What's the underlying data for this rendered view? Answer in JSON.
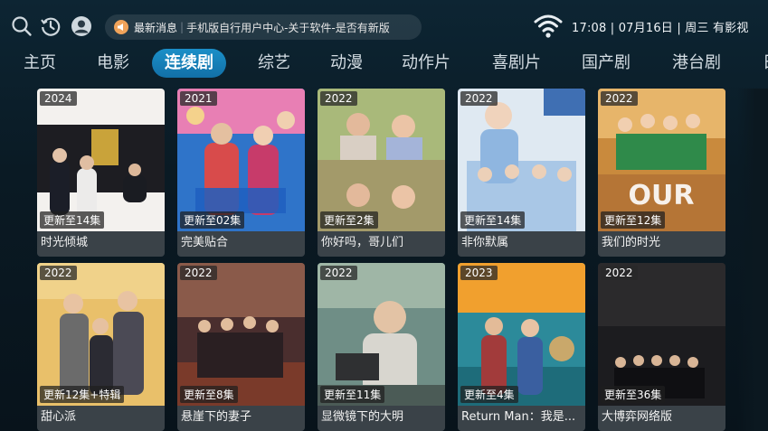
{
  "header": {
    "icons": [
      "search-icon",
      "history-icon",
      "user-icon"
    ],
    "news_label": "最新消息",
    "news_text": "手机版自行用户中心-关于软件-是否有新版",
    "status_text": "17:08 | 07月16日 | 周三  有影视"
  },
  "nav": {
    "tabs": [
      "主页",
      "电影",
      "连续剧",
      "综艺",
      "动漫",
      "动作片",
      "喜剧片",
      "国产剧",
      "港台剧",
      "日"
    ],
    "active": "连续剧"
  },
  "colors": {
    "accent": "#1a86c0",
    "title_bar": "#3a4248"
  },
  "cards": [
    {
      "year": "2024",
      "episodes": "更新至14集",
      "title": "时光倾城"
    },
    {
      "year": "2021",
      "episodes": "更新至02集",
      "title": "完美贴合"
    },
    {
      "year": "2022",
      "episodes": "更新至2集",
      "title": "你好吗，哥儿们"
    },
    {
      "year": "2022",
      "episodes": "更新至14集",
      "title": "非你默属"
    },
    {
      "year": "2022",
      "episodes": "更新至12集",
      "title": "我们的时光"
    },
    {
      "year": "2022",
      "episodes": "更新12集+特辑",
      "title": "甜心派"
    },
    {
      "year": "2022",
      "episodes": "更新至8集",
      "title": "悬崖下的妻子"
    },
    {
      "year": "2022",
      "episodes": "更新至11集",
      "title": "显微镜下的大明"
    },
    {
      "year": "2023",
      "episodes": "更新至4集",
      "title": "Return Man：我是..."
    },
    {
      "year": "2022",
      "episodes": "更新至36集",
      "title": "大博弈网络版"
    }
  ]
}
